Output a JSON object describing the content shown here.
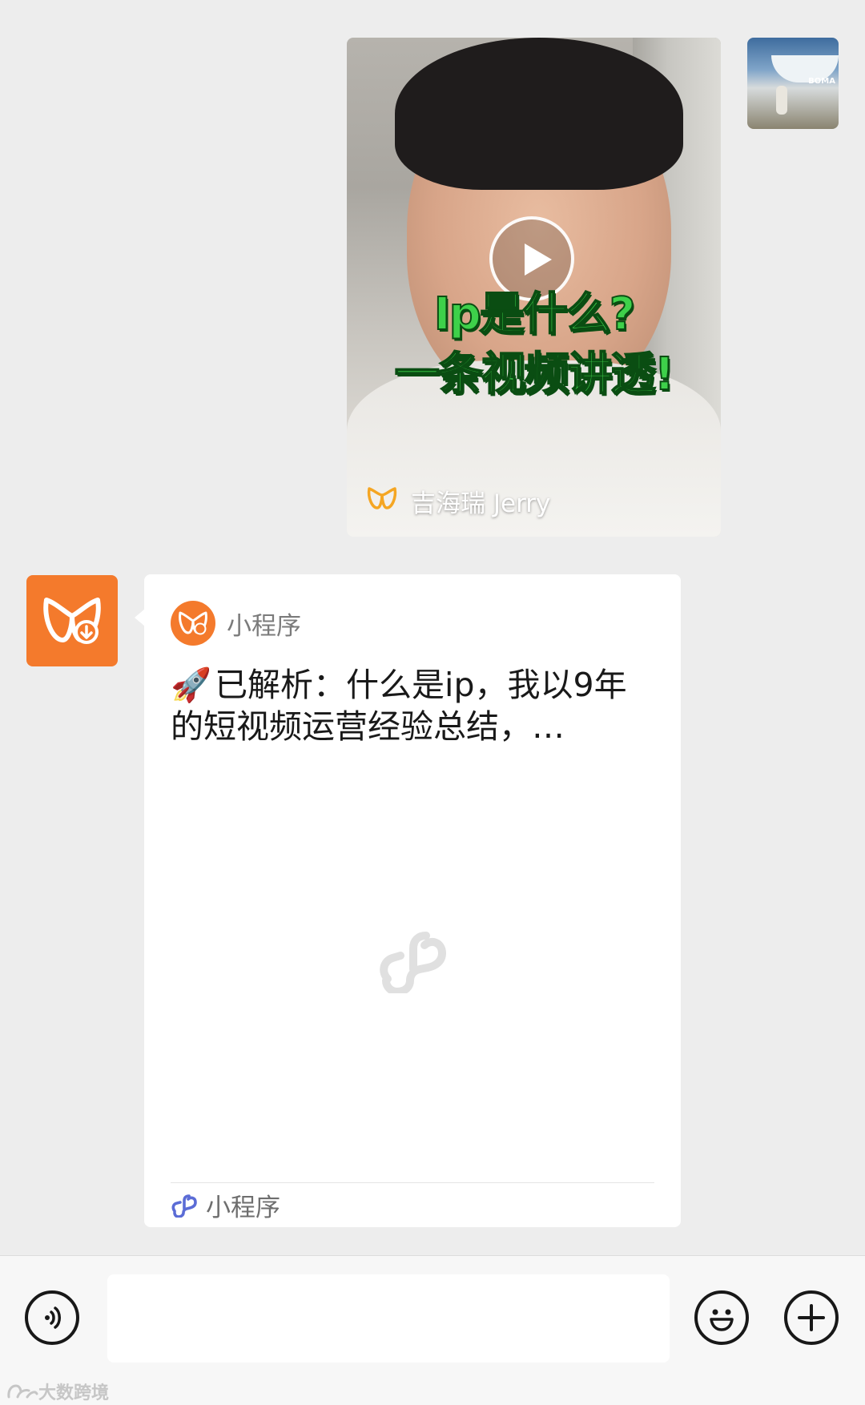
{
  "video_message": {
    "caption_line1": "Ip是什么?",
    "caption_line2": "一条视频讲透!",
    "author": "吉海瑞 Jerry",
    "play_icon": "play-icon"
  },
  "my_avatar": {
    "sign_text": "BOMA"
  },
  "mini_program_card": {
    "app_name": "小程序",
    "title": "已解析：什么是ip，我以9年的短视频运营经验总结，…",
    "title_emoji": "🚀",
    "footer_label": "小程序",
    "accent_color": "#f47a2c",
    "link_icon_color": "#5b6cd6"
  },
  "input_bar": {
    "placeholder": "",
    "value": ""
  },
  "watermark": {
    "text": "大数跨境"
  }
}
